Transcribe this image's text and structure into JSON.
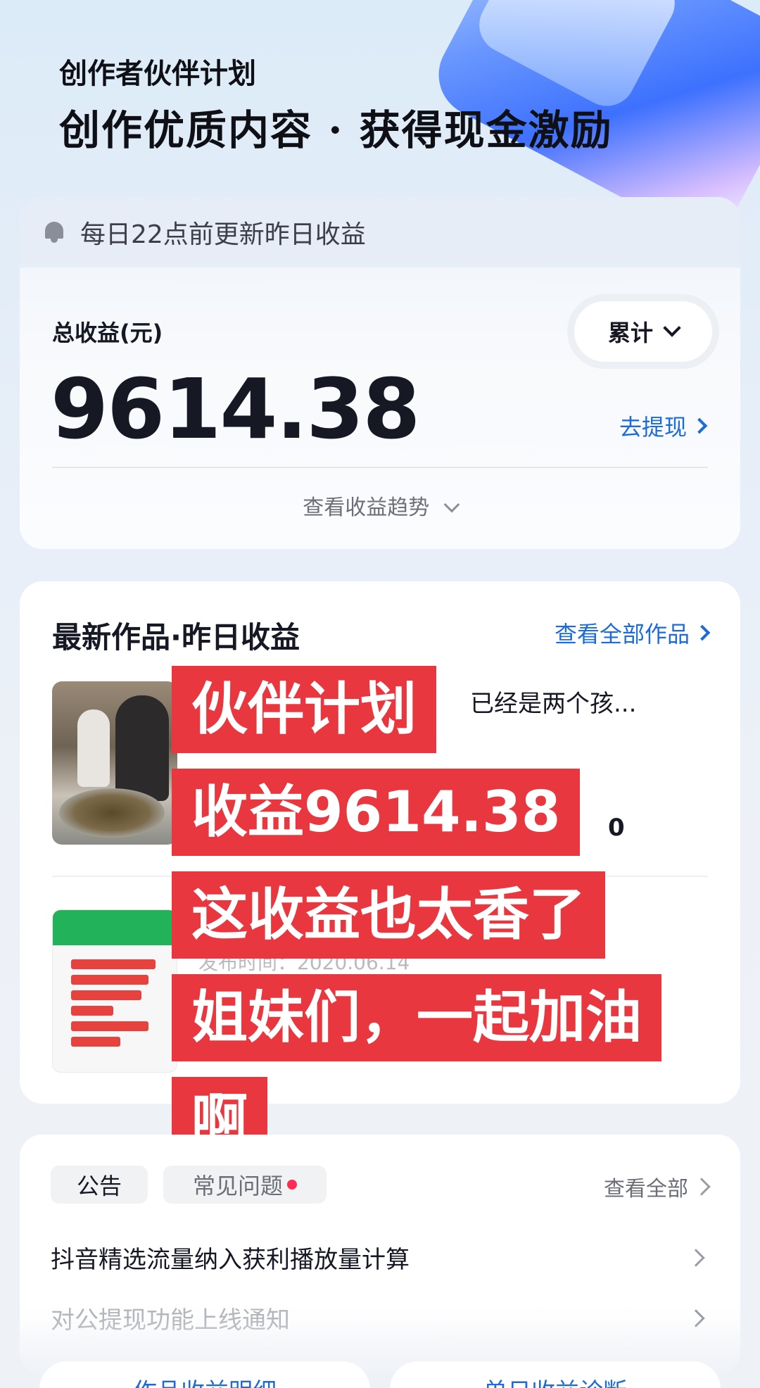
{
  "hero": {
    "subtitle": "创作者伙伴计划",
    "title": "创作优质内容 · 获得现金激励"
  },
  "earnings_card": {
    "notice": "每日22点前更新昨日收益",
    "total_label": "总收益(元)",
    "total_value": "9614.38",
    "period_button": "累计",
    "withdraw_link": "去提现",
    "trend_link": "查看收益趋势"
  },
  "works_card": {
    "title": "最新作品·昨日收益",
    "view_all": "查看全部作品",
    "items": [
      {
        "text": "已经是两个孩...",
        "value": "0"
      },
      {
        "date": "发布时间：2020.06.14"
      }
    ]
  },
  "overlay_captions": [
    "伙伴计划",
    "收益9614.38",
    "这收益也太香了",
    "姐妹们，一起加油",
    "啊"
  ],
  "announcements": {
    "tabs": [
      "公告",
      "常见问题"
    ],
    "view_all": "查看全部",
    "items": [
      "抖音精选流量纳入获利播放量计算",
      "对公提现功能上线通知"
    ]
  },
  "bottom_buttons": [
    "作品收益明细",
    "单日收益诊断"
  ],
  "colors": {
    "accent_blue": "#1b6bd8",
    "caption_red": "#e8373e",
    "badge_dot": "#fe2c55"
  }
}
